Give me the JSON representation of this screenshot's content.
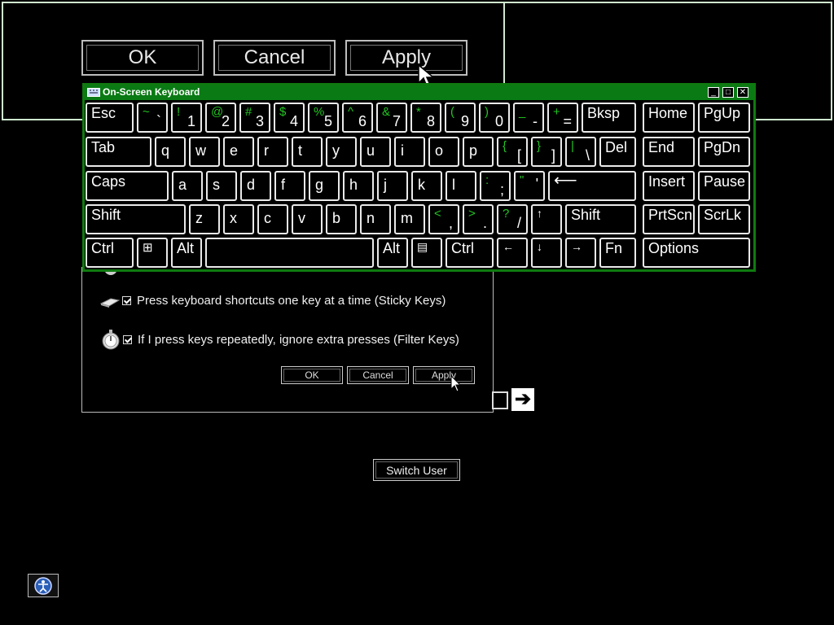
{
  "magnifier": {
    "ok_label": "OK",
    "cancel_label": "Cancel",
    "apply_label": "Apply"
  },
  "dialog": {
    "options": [
      {
        "label": "Press keyboard shortcuts one key at a time (Sticky Keys)",
        "checked": true,
        "icon": "sticky-keys-icon"
      },
      {
        "label": "If I press keys repeatedly, ignore extra presses (Filter Keys)",
        "checked": true,
        "icon": "filter-keys-icon"
      }
    ],
    "ok_label": "OK",
    "cancel_label": "Cancel",
    "apply_label": "Apply"
  },
  "osk": {
    "title": "On-Screen Keyboard",
    "shift_color": "#22c422",
    "title_color": "#0a7a14",
    "keys": {
      "esc": "Esc",
      "tilde_s": "~",
      "tilde_l": "`",
      "k1_s": "!",
      "k1_l": "1",
      "k2_s": "@",
      "k2_l": "2",
      "k3_s": "#",
      "k3_l": "3",
      "k4_s": "$",
      "k4_l": "4",
      "k5_s": "%",
      "k5_l": "5",
      "k6_s": "^",
      "k6_l": "6",
      "k7_s": "&",
      "k7_l": "7",
      "k8_s": "*",
      "k8_l": "8",
      "k9_s": "(",
      "k9_l": "9",
      "k0_s": ")",
      "k0_l": "0",
      "minus_s": "_",
      "minus_l": "-",
      "plus_s": "+",
      "plus_l": "=",
      "bksp": "Bksp",
      "home": "Home",
      "pgup": "PgUp",
      "tab": "Tab",
      "q": "q",
      "w": "w",
      "e": "e",
      "r": "r",
      "t": "t",
      "y": "y",
      "u": "u",
      "i": "i",
      "o": "o",
      "p": "p",
      "lbr_s": "{",
      "lbr_l": "[",
      "rbr_s": "}",
      "rbr_l": "]",
      "pipe_s": "|",
      "pipe_l": "\\",
      "del": "Del",
      "end": "End",
      "pgdn": "PgDn",
      "caps": "Caps",
      "a": "a",
      "s": "s",
      "d": "d",
      "f": "f",
      "g": "g",
      "h": "h",
      "j": "j",
      "k": "k",
      "l": "l",
      "semi_s": ":",
      "semi_l": ";",
      "quote_s": "\"",
      "quote_l": "'",
      "enter": "⟵",
      "insert": "Insert",
      "pause": "Pause",
      "shift": "Shift",
      "z": "z",
      "x": "x",
      "c": "c",
      "v": "v",
      "b": "b",
      "n": "n",
      "m": "m",
      "comma_s": "<",
      "comma_l": ",",
      "period_s": ">",
      "period_l": ".",
      "slash_s": "?",
      "slash_l": "/",
      "up": "↑",
      "rshift": "Shift",
      "prtscn": "PrtScn",
      "scrlk": "ScrLk",
      "ctrl": "Ctrl",
      "win": "⊞",
      "alt": "Alt",
      "ralt": "Alt",
      "menu": "▤",
      "rctrl": "Ctrl",
      "left": "←",
      "down": "↓",
      "right": "→",
      "fn": "Fn",
      "options": "Options"
    }
  },
  "logon": {
    "go_arrow": "➔",
    "switch_user_label": "Switch User"
  }
}
